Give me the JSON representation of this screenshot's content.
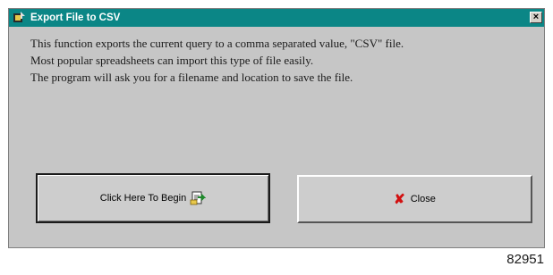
{
  "window": {
    "title": "Export File to CSV",
    "close_glyph": "×",
    "app_icon": "application-icon",
    "colors": {
      "titlebar": "#0b8686",
      "face": "#c6c6c6"
    }
  },
  "description": [
    "This function exports the current query to a comma separated value, \"CSV\" file.",
    "Most popular spreadsheets can import this type of file easily.",
    "The program will ask you for a filename and location to save the file."
  ],
  "buttons": {
    "begin": {
      "label": "Click Here To Begin",
      "icon": "export-file-icon"
    },
    "close": {
      "label": "Close",
      "icon": "red-x-icon",
      "glyph": "✘"
    }
  },
  "figure_number": "82951"
}
